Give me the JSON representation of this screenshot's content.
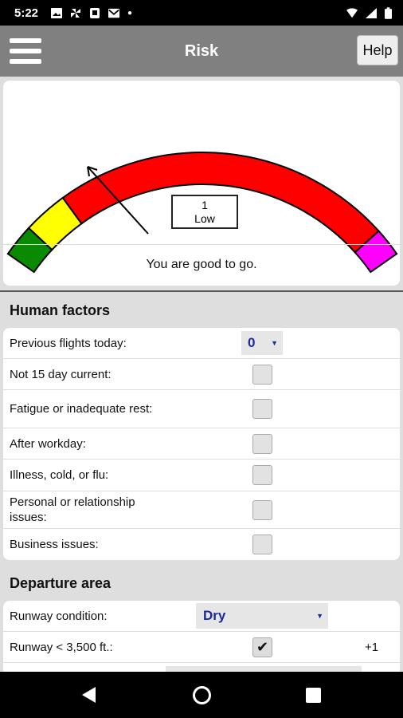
{
  "status_bar": {
    "time": "5:22"
  },
  "app_bar": {
    "title": "Risk",
    "help_label": "Help"
  },
  "gauge": {
    "level_number": "1",
    "level_label": "Low",
    "message": "You are good to go.",
    "colors": {
      "green": "#0a8a00",
      "yellow": "#ffff00",
      "red": "#ff0000",
      "magenta": "#ff00ff"
    }
  },
  "human_factors": {
    "title": "Human factors",
    "rows": [
      {
        "label": "Previous flights today:",
        "type": "select",
        "value": "0"
      },
      {
        "label": "Not 15 day current:",
        "type": "checkbox",
        "checked": false
      },
      {
        "label": "Fatigue or inadequate rest:",
        "type": "checkbox",
        "checked": false
      },
      {
        "label": "After workday:",
        "type": "checkbox",
        "checked": false
      },
      {
        "label": "Illness, cold, or flu:",
        "type": "checkbox",
        "checked": false
      },
      {
        "label": "Personal or relationship issues:",
        "type": "checkbox",
        "checked": false
      },
      {
        "label": "Business issues:",
        "type": "checkbox",
        "checked": false
      }
    ]
  },
  "departure_area": {
    "title": "Departure area",
    "rows": [
      {
        "label": "Runway condition:",
        "type": "select",
        "value": "Dry"
      },
      {
        "label": "Runway < 3,500 ft.:",
        "type": "checkbox",
        "checked": true,
        "points": "+1"
      }
    ]
  }
}
